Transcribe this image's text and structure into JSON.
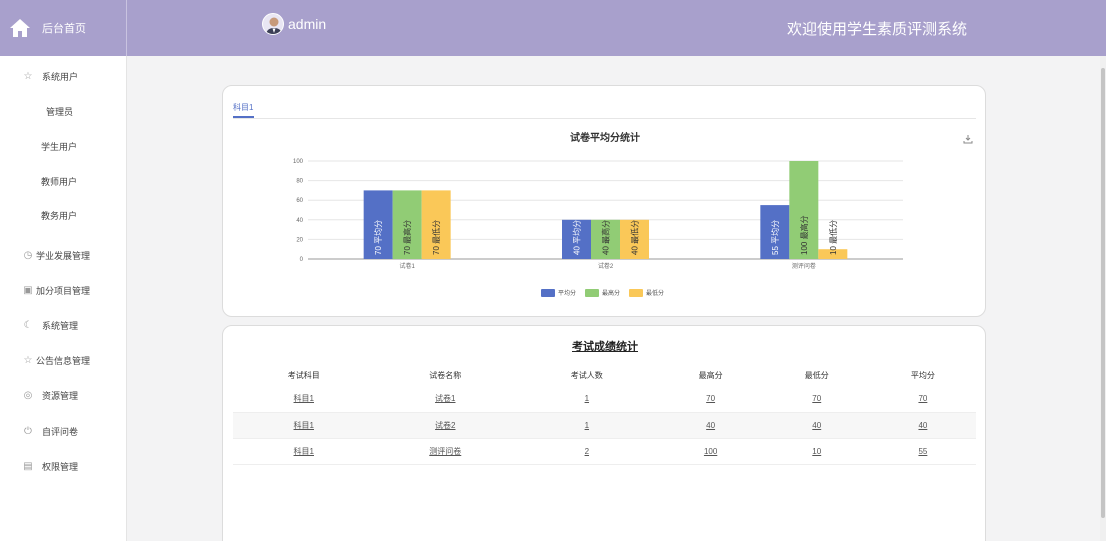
{
  "header": {
    "home_label": "后台首页",
    "user_name": "admin",
    "welcome": "欢迎使用学生素质评测系统"
  },
  "sidebar": {
    "items": [
      {
        "label": "系统用户",
        "icon": "star-outline-icon"
      },
      {
        "label": "管理员",
        "icon": ""
      },
      {
        "label": "学生用户",
        "icon": ""
      },
      {
        "label": "教师用户",
        "icon": ""
      },
      {
        "label": "教务用户",
        "icon": ""
      },
      {
        "label": "学业发展管理",
        "icon": "clock-icon"
      },
      {
        "label": "加分项目管理",
        "icon": "calendar-icon"
      },
      {
        "label": "系统管理",
        "icon": "moon-icon"
      },
      {
        "label": "公告信息管理",
        "icon": "star-outline-icon"
      },
      {
        "label": "资源管理",
        "icon": "compass-icon"
      },
      {
        "label": "自评问卷",
        "icon": "power-icon"
      },
      {
        "label": "权限管理",
        "icon": "image-icon"
      }
    ]
  },
  "chart_card": {
    "tab_label": "科目1",
    "title": "试卷平均分统计"
  },
  "chart_data": {
    "type": "bar",
    "title": "试卷平均分统计",
    "categories": [
      "试卷1",
      "试卷2",
      "测评问卷"
    ],
    "series": [
      {
        "name": "平均分",
        "values": [
          70,
          40,
          55
        ],
        "color": "#5470c6"
      },
      {
        "name": "最高分",
        "values": [
          70,
          40,
          100
        ],
        "color": "#91cc75"
      },
      {
        "name": "最低分",
        "values": [
          70,
          40,
          10
        ],
        "color": "#fac858"
      }
    ],
    "ylim": [
      0,
      100
    ],
    "yticks": [
      0,
      20,
      40,
      60,
      80,
      100
    ],
    "grid": true,
    "legend": "bottom-center"
  },
  "table_card": {
    "title": "考试成绩统计",
    "columns": [
      "考试科目",
      "试卷名称",
      "考试人数",
      "最高分",
      "最低分",
      "平均分"
    ],
    "rows": [
      [
        "科目1",
        "试卷1",
        "1",
        "70",
        "70",
        "70"
      ],
      [
        "科目1",
        "试卷2",
        "1",
        "40",
        "40",
        "40"
      ],
      [
        "科目1",
        "测评问卷",
        "2",
        "100",
        "10",
        "55"
      ]
    ]
  }
}
